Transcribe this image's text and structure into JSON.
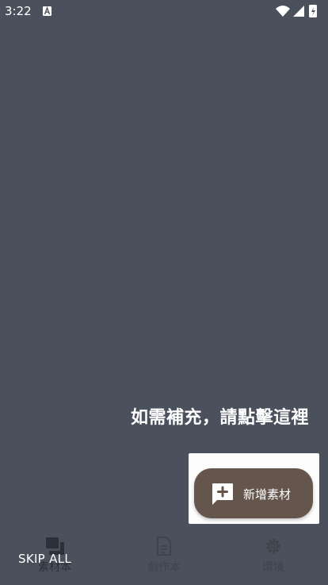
{
  "status_bar": {
    "time": "3:22",
    "icons": [
      "a-notification-icon",
      "wifi-icon",
      "cell-signal-icon",
      "battery-icon"
    ]
  },
  "overlay": {
    "hint_text": "如需補充，請點擊這裡",
    "skip_label": "SKIP ALL"
  },
  "fab": {
    "label": "新增素材",
    "icon": "add-comment-icon",
    "color": "#64564d"
  },
  "bottom_nav": {
    "items": [
      {
        "label": "素材本",
        "icon": "materials-icon",
        "selected": true
      },
      {
        "label": "劇作本",
        "icon": "document-icon",
        "selected": false
      },
      {
        "label": "環境",
        "icon": "gear-icon",
        "selected": false
      }
    ]
  },
  "colors": {
    "scrim": "#4b515c",
    "fab": "#64564d",
    "text": "#ffffff"
  }
}
